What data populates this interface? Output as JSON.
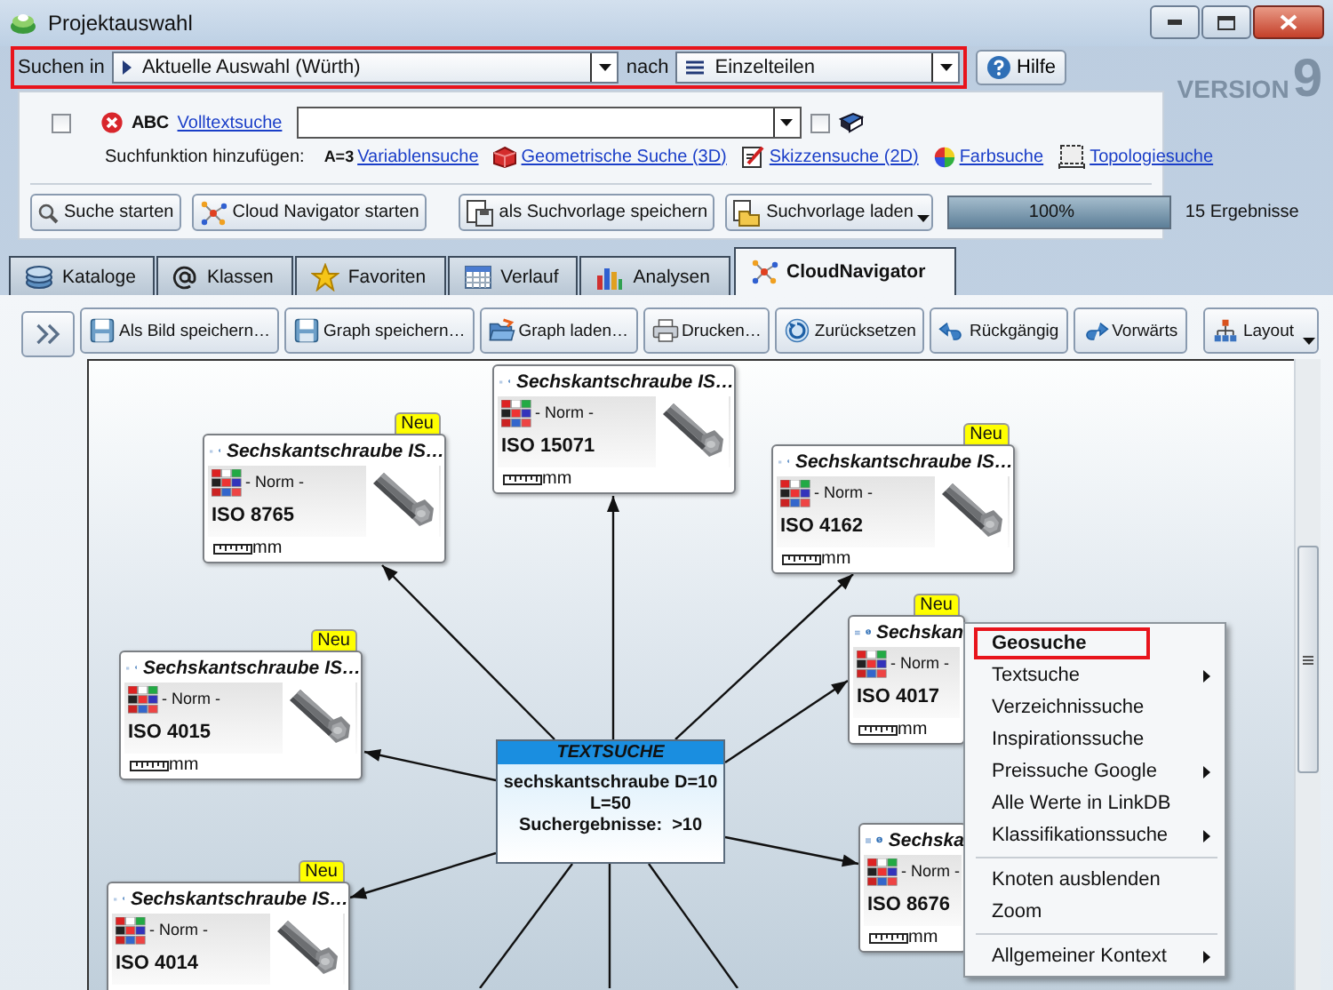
{
  "window": {
    "title": "Projektauswahl"
  },
  "search_bar": {
    "highlighted": true,
    "label": "Suchen in",
    "scope": "Aktuelle Auswahl (Würth)",
    "connector": "nach",
    "target": "Einzelteilen"
  },
  "help_button": "Hilfe",
  "version_logo": {
    "text": "VERSION",
    "number": "9"
  },
  "fulltext": {
    "checked": false,
    "icon_text": "ABC",
    "link": "Volltextsuche",
    "option_checked": false
  },
  "add_search": {
    "label": "Suchfunktion hinzufügen:",
    "items": [
      {
        "kind": "variable",
        "prefix": "A=3",
        "label": "Variablensuche"
      },
      {
        "kind": "geometric",
        "label": "Geometrische Suche (3D)"
      },
      {
        "kind": "sketch",
        "label": "Skizzensuche (2D)"
      },
      {
        "kind": "color",
        "label": "Farbsuche"
      },
      {
        "kind": "topology",
        "label": "Topologiesuche"
      }
    ]
  },
  "actions": [
    {
      "kind": "search",
      "label": "Suche starten",
      "dropdown": false
    },
    {
      "kind": "cloud",
      "label": "Cloud Navigator starten",
      "dropdown": false
    },
    {
      "kind": "save",
      "label": "als Suchvorlage speichern",
      "dropdown": false
    },
    {
      "kind": "load",
      "label": "Suchvorlage laden",
      "dropdown": true
    }
  ],
  "progress": {
    "level": 1,
    "reading": "100%"
  },
  "result_count": "15 Ergebnisse",
  "tabs": [
    {
      "kind": "catalog",
      "label": "Kataloge",
      "selected": false
    },
    {
      "kind": "classes",
      "label": "Klassen",
      "selected": false
    },
    {
      "kind": "favorites",
      "label": "Favoriten",
      "selected": false
    },
    {
      "kind": "history",
      "label": "Verlauf",
      "selected": false
    },
    {
      "kind": "analysis",
      "label": "Analysen",
      "selected": false
    },
    {
      "kind": "cloud",
      "label": "CloudNavigator",
      "selected": true
    }
  ],
  "toolbar": [
    {
      "kind": "save-image",
      "label": "Als Bild speichern…",
      "dropdown": false
    },
    {
      "kind": "save-graph",
      "label": "Graph speichern…",
      "dropdown": false
    },
    {
      "kind": "load-graph",
      "label": "Graph laden…",
      "dropdown": false
    },
    {
      "kind": "print",
      "label": "Drucken…",
      "dropdown": false
    },
    {
      "kind": "reset",
      "label": "Zurücksetzen",
      "dropdown": false
    },
    {
      "kind": "undo",
      "label": "Rückgängig",
      "dropdown": false
    },
    {
      "kind": "redo",
      "label": "Vorwärts",
      "dropdown": false
    },
    {
      "kind": "layout",
      "label": "Layout",
      "dropdown": true
    }
  ],
  "graph": {
    "center": {
      "title": "TEXTSUCHE",
      "lines": [
        "sechskantschraube D=10",
        "L=50",
        "Suchergebnisse:  >10"
      ]
    },
    "nodes": [
      {
        "title": "Sechskantschraube IS…",
        "category": "- Norm -",
        "code": "ISO 15071",
        "unit": "mm",
        "new": false,
        "picture": true
      },
      {
        "title": "Sechskantschraube IS…",
        "category": "- Norm -",
        "code": "ISO 8765",
        "unit": "mm",
        "new": true,
        "badge": "Neu",
        "picture": true
      },
      {
        "title": "Sechskantschraube IS…",
        "category": "- Norm -",
        "code": "ISO 4162",
        "unit": "mm",
        "new": true,
        "badge": "Neu",
        "picture": true
      },
      {
        "title": "Sechskantschraube IS…",
        "category": "- Norm -",
        "code": "ISO 4015",
        "unit": "mm",
        "new": true,
        "badge": "Neu",
        "picture": true
      },
      {
        "title": "Sechskan",
        "category": "- Norm -",
        "code": "ISO 4017",
        "unit": "mm",
        "new": true,
        "badge": "Neu",
        "picture": false
      },
      {
        "title": "Sechska",
        "category": "- Norm -",
        "code": "ISO 8676",
        "unit": "mm",
        "new": false,
        "picture": false
      },
      {
        "title": "Sechskantschraube IS…",
        "category": "- Norm -",
        "code": "ISO 4014",
        "new": true,
        "badge": "Neu",
        "picture": true
      }
    ]
  },
  "context_menu": {
    "items": [
      {
        "kind": "item",
        "label": "Geosuche",
        "highlighted": true,
        "submenu": false
      },
      {
        "kind": "item",
        "label": "Textsuche",
        "highlighted": false,
        "submenu": true
      },
      {
        "kind": "item",
        "label": "Verzeichnissuche",
        "highlighted": false,
        "submenu": false
      },
      {
        "kind": "item",
        "label": "Inspirationssuche",
        "highlighted": false,
        "submenu": false
      },
      {
        "kind": "item",
        "label": "Preissuche Google",
        "highlighted": false,
        "submenu": true
      },
      {
        "kind": "item",
        "label": "Alle Werte in LinkDB",
        "highlighted": false,
        "submenu": false
      },
      {
        "kind": "item",
        "label": "Klassifikationssuche",
        "highlighted": false,
        "submenu": true
      },
      {
        "kind": "separator"
      },
      {
        "kind": "item",
        "label": "Knoten ausblenden",
        "highlighted": false,
        "submenu": false
      },
      {
        "kind": "item",
        "label": "Zoom",
        "highlighted": false,
        "submenu": false
      },
      {
        "kind": "separator"
      },
      {
        "kind": "item",
        "label": "Allgemeiner Kontext",
        "highlighted": false,
        "submenu": true
      }
    ]
  }
}
